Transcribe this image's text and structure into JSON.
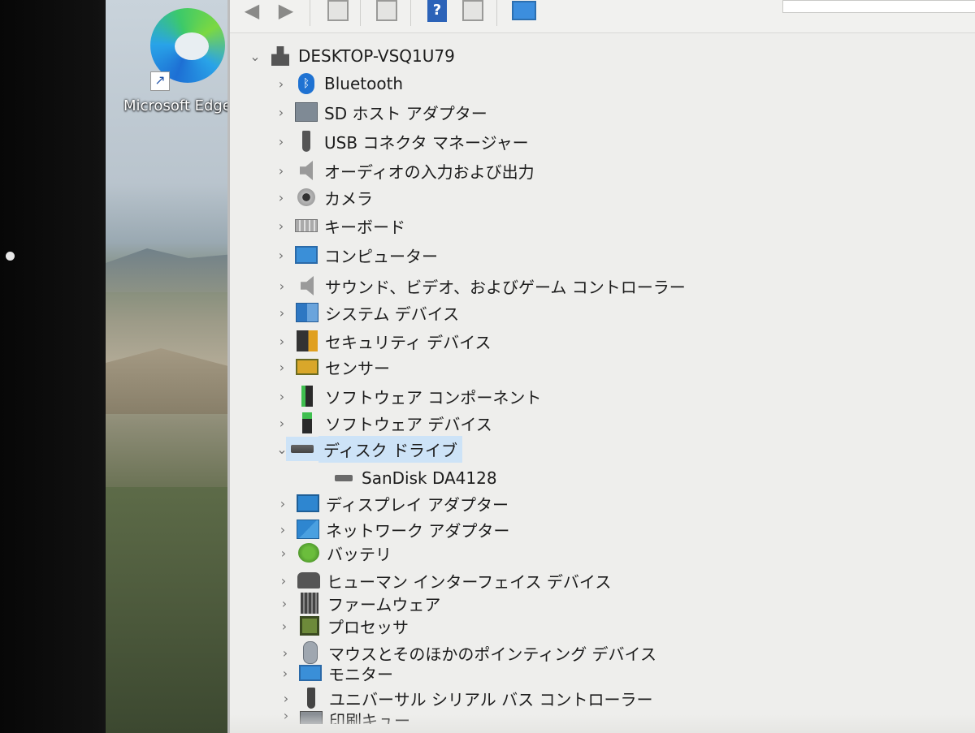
{
  "desktop": {
    "shortcut_label": "Microsoft Edge"
  },
  "toolbar": {
    "buttons": [
      "back",
      "forward",
      "show-hide-console-tree",
      "properties",
      "help",
      "action-pane",
      "scan-hardware"
    ]
  },
  "tree": {
    "root": "DESKTOP-VSQ1U79",
    "categories": [
      {
        "label": "Bluetooth",
        "icon": "bluetooth-icon",
        "expanded": false
      },
      {
        "label": "SD ホスト アダプター",
        "icon": "sd-host-adapter-icon",
        "expanded": false
      },
      {
        "label": "USB コネクタ マネージャー",
        "icon": "usb-connector-icon",
        "expanded": false
      },
      {
        "label": "オーディオの入力および出力",
        "icon": "speaker-icon",
        "expanded": false
      },
      {
        "label": "カメラ",
        "icon": "camera-icon",
        "expanded": false
      },
      {
        "label": "キーボード",
        "icon": "keyboard-icon",
        "expanded": false
      },
      {
        "label": "コンピューター",
        "icon": "monitor-icon",
        "expanded": false
      },
      {
        "label": "サウンド、ビデオ、およびゲーム コントローラー",
        "icon": "speaker-icon",
        "expanded": false
      },
      {
        "label": "システム デバイス",
        "icon": "system-device-icon",
        "expanded": false
      },
      {
        "label": "セキュリティ デバイス",
        "icon": "security-device-icon",
        "expanded": false
      },
      {
        "label": "センサー",
        "icon": "sensor-icon",
        "expanded": false
      },
      {
        "label": "ソフトウェア コンポーネント",
        "icon": "software-component-icon",
        "expanded": false
      },
      {
        "label": "ソフトウェア デバイス",
        "icon": "software-device-icon",
        "expanded": false
      },
      {
        "label": "ディスク ドライブ",
        "icon": "disk-drive-icon",
        "expanded": true,
        "selected": true,
        "children": [
          {
            "label": "SanDisk DA4128",
            "icon": "disk-drive-icon"
          }
        ]
      },
      {
        "label": "ディスプレイ アダプター",
        "icon": "display-adapter-icon",
        "expanded": false
      },
      {
        "label": "ネットワーク アダプター",
        "icon": "network-adapter-icon",
        "expanded": false
      },
      {
        "label": "バッテリ",
        "icon": "battery-icon",
        "expanded": false
      },
      {
        "label": "ヒューマン インターフェイス デバイス",
        "icon": "hid-icon",
        "expanded": false
      },
      {
        "label": "ファームウェア",
        "icon": "firmware-icon",
        "expanded": false
      },
      {
        "label": "プロセッサ",
        "icon": "processor-icon",
        "expanded": false
      },
      {
        "label": "マウスとそのほかのポインティング デバイス",
        "icon": "mouse-icon",
        "expanded": false
      },
      {
        "label": "モニター",
        "icon": "monitor-icon",
        "expanded": false
      },
      {
        "label": "ユニバーサル シリアル バス コントローラー",
        "icon": "usb-controller-icon",
        "expanded": false
      },
      {
        "label": "印刷キュー",
        "icon": "print-queue-icon",
        "expanded": false
      }
    ]
  }
}
